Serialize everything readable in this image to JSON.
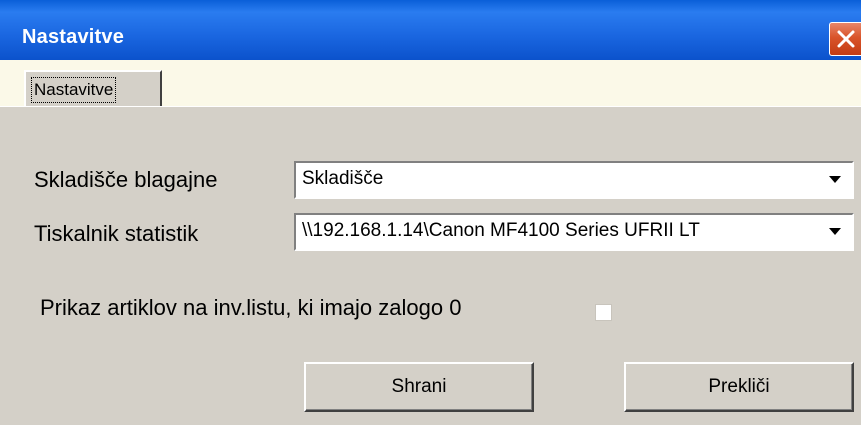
{
  "window": {
    "title": "Nastavitve"
  },
  "tabs": [
    {
      "label": "Nastavitve",
      "active": true
    }
  ],
  "form": {
    "warehouse": {
      "label": "Skladišče blagajne",
      "value": "Skladišče"
    },
    "printer": {
      "label": "Tiskalnik statistik",
      "value": "\\\\192.168.1.14\\Canon MF4100 Series UFRII LT"
    },
    "show_zero_stock": {
      "label": "Prikaz artiklov na inv.listu, ki imajo zalogo 0",
      "checked": false
    }
  },
  "buttons": {
    "save_label": "Shrani",
    "cancel_label": "Prekliči"
  },
  "colors": {
    "titlebar": "#0a5fd8",
    "close_button": "#d9542a",
    "dialog_face": "#d4d0c8",
    "tabstrip": "#fbf9e8"
  },
  "icons": {
    "close": "close-x-icon",
    "dropdown": "chevron-down-icon"
  }
}
